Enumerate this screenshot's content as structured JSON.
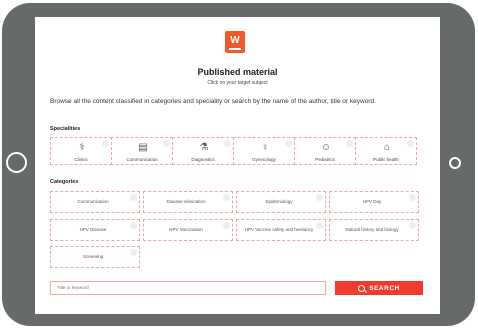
{
  "header": {
    "logo_glyph": "W",
    "title": "Published material",
    "subtitle": "Click on your target subject",
    "description": "Browse all the content classified in categories and speciality or search by the name of the author, title or keyword."
  },
  "specialities": {
    "label": "Specialities",
    "items": [
      {
        "label": "Clinics",
        "icon": "stethoscope-icon",
        "glyph": "⚕"
      },
      {
        "label": "Communication",
        "icon": "document-icon",
        "glyph": "▤"
      },
      {
        "label": "Diagnostics",
        "icon": "microscope-icon",
        "glyph": "⚗"
      },
      {
        "label": "Gynecology",
        "icon": "uterus-icon",
        "glyph": "♀"
      },
      {
        "label": "Pediatrics",
        "icon": "child-icon",
        "glyph": "☺"
      },
      {
        "label": "Public health",
        "icon": "building-icon",
        "glyph": "⌂"
      }
    ]
  },
  "categories": {
    "label": "Categories",
    "items": [
      {
        "label": "Communication"
      },
      {
        "label": "Disease elimination"
      },
      {
        "label": "Epidemiology"
      },
      {
        "label": "HPV Day"
      },
      {
        "label": "HPV Disease"
      },
      {
        "label": "HPV Vaccination"
      },
      {
        "label": "HPV Vaccine safety and hesitancy"
      },
      {
        "label": "Natural history and biology"
      },
      {
        "label": "Screening"
      }
    ]
  },
  "search": {
    "placeholder": "Title or keyword",
    "button_label": "SEARCH"
  },
  "colors": {
    "accent": "#ef3b2d",
    "logo": "#f05a28",
    "frame": "#666a6b"
  }
}
